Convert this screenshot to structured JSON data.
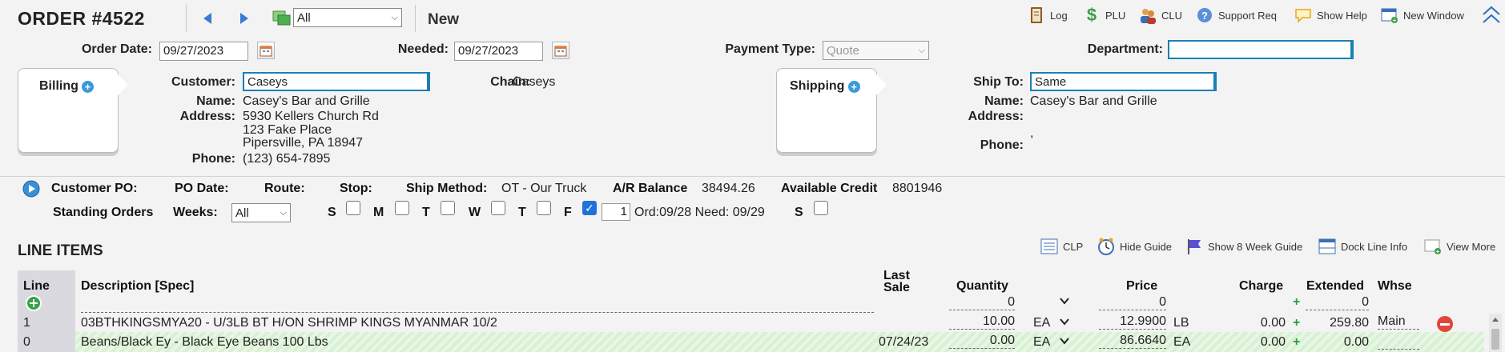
{
  "header": {
    "title": "ORDER #4522",
    "filter_value": "All",
    "mode": "New"
  },
  "toolbar": {
    "log": "Log",
    "plu": "PLU",
    "clu": "CLU",
    "support": "Support Req",
    "help": "Show Help",
    "new_window": "New Window"
  },
  "order": {
    "order_date_label": "Order Date:",
    "order_date": "09/27/2023",
    "needed_label": "Needed:",
    "needed": "09/27/2023",
    "payment_label": "Payment Type:",
    "payment_placeholder": "Quote",
    "department_label": "Department:",
    "department": ""
  },
  "billing": {
    "tab_label": "Billing",
    "customer_label": "Customer:",
    "customer": "Caseys",
    "name_label": "Name:",
    "name": "Casey's Bar and Grille",
    "address_label": "Address:",
    "address1": "5930 Kellers Church Rd",
    "address2": "123 Fake Place",
    "address3": "Pipersville, PA 18947",
    "phone_label": "Phone:",
    "phone": "(123) 654-7895",
    "chain_label": "Chain:",
    "chain": "Caseys"
  },
  "shipping": {
    "tab_label": "Shipping",
    "ship_to_label": "Ship To:",
    "ship_to": "Same",
    "name_label": "Name:",
    "name": "Casey's Bar and Grille",
    "address_label": "Address:",
    "address_extra": ",",
    "phone_label": "Phone:"
  },
  "details": {
    "customer_po": "Customer PO:",
    "po_date": "PO Date:",
    "route": "Route:",
    "stop": "Stop:",
    "ship_method_label": "Ship Method:",
    "ship_method": "OT - Our Truck",
    "ar_label": "A/R Balance",
    "ar_value": "38494.26",
    "credit_label": "Available Credit",
    "credit_value": "8801946",
    "standing_orders": "Standing Orders",
    "weeks_label": "Weeks:",
    "weeks_value": "All",
    "days": [
      "S",
      "M",
      "T",
      "W",
      "T",
      "F",
      "S"
    ],
    "friday_qty": "1",
    "ord_need": "Ord:09/28 Need: 09/29"
  },
  "line_items": {
    "title": "LINE ITEMS",
    "actions": {
      "clp": "CLP",
      "hide_guide": "Hide Guide",
      "show_8_week": "Show 8 Week Guide",
      "dock": "Dock Line Info",
      "view_more": "View More"
    },
    "columns": {
      "line": "Line",
      "description": "Description [Spec]",
      "last_sale_1": "Last",
      "last_sale_2": "Sale",
      "quantity": "Quantity",
      "price": "Price",
      "charge": "Charge",
      "extended": "Extended",
      "whse": "Whse"
    },
    "totals": {
      "quantity": "0",
      "price": "0",
      "extended": "0"
    },
    "rows": [
      {
        "line": "1",
        "description": "03BTHKINGSMYA20 - U/3LB BT H/ON SHRIMP KINGS MYANMAR 10/2",
        "last_sale": "",
        "quantity": "10.00",
        "unit": "EA",
        "price": "12.9900",
        "price_unit": "LB",
        "charge": "0.00",
        "extended": "259.80",
        "whse": "Main"
      },
      {
        "line": "0",
        "description": "Beans/Black Ey - Black Eye Beans 100 Lbs",
        "last_sale": "07/24/23",
        "quantity": "0.00",
        "unit": "EA",
        "price": "86.6640",
        "price_unit": "EA",
        "charge": "0.00",
        "extended": "0.00",
        "whse": ""
      }
    ]
  }
}
